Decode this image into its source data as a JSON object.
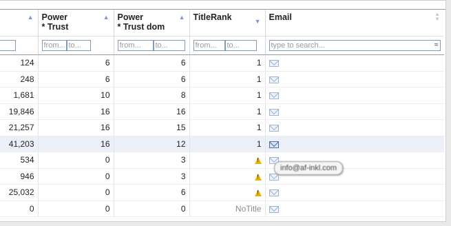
{
  "columns": [
    {
      "label1": "",
      "label2": "",
      "sort": "up"
    },
    {
      "label1": "Power",
      "label2": "* Trust",
      "sort": "up"
    },
    {
      "label1": "Power",
      "label2": "* Trust dom",
      "sort": "up"
    },
    {
      "label1": "TitleRank",
      "label2": "",
      "sort": "down"
    },
    {
      "label1": "Email",
      "label2": "",
      "sort": "both"
    }
  ],
  "filters": {
    "from": "from...",
    "to": "to...",
    "search_placeholder": "type to search...",
    "clear_glyph": "≈"
  },
  "rows": [
    {
      "c0": "124",
      "c1": "6",
      "c2": "6",
      "c3": "1"
    },
    {
      "c0": "248",
      "c1": "6",
      "c2": "6",
      "c3": "1"
    },
    {
      "c0": "1,681",
      "c1": "10",
      "c2": "8",
      "c3": "1"
    },
    {
      "c0": "19,846",
      "c1": "16",
      "c2": "16",
      "c3": "1"
    },
    {
      "c0": "21,257",
      "c1": "16",
      "c2": "15",
      "c3": "1"
    },
    {
      "c0": "41,203",
      "c1": "16",
      "c2": "12",
      "c3": "1"
    },
    {
      "c0": "534",
      "c1": "0",
      "c2": "3",
      "c3": "warning"
    },
    {
      "c0": "946",
      "c1": "0",
      "c2": "3",
      "c3": "warning"
    },
    {
      "c0": "25,032",
      "c1": "0",
      "c2": "6",
      "c3": "warning"
    },
    {
      "c0": "0",
      "c1": "0",
      "c2": "0",
      "c3": "NoTitle"
    }
  ],
  "tooltip": "info@af-inkl.com",
  "icons": {
    "sort_asc": "sort-asc-icon",
    "sort_desc": "sort-desc-icon",
    "email": "envelope-icon",
    "warning": "warning-icon"
  },
  "colors": {
    "sort_arrow": "#7b95d8",
    "highlight_row": "#ebeff7",
    "warning": "#e8b400"
  }
}
